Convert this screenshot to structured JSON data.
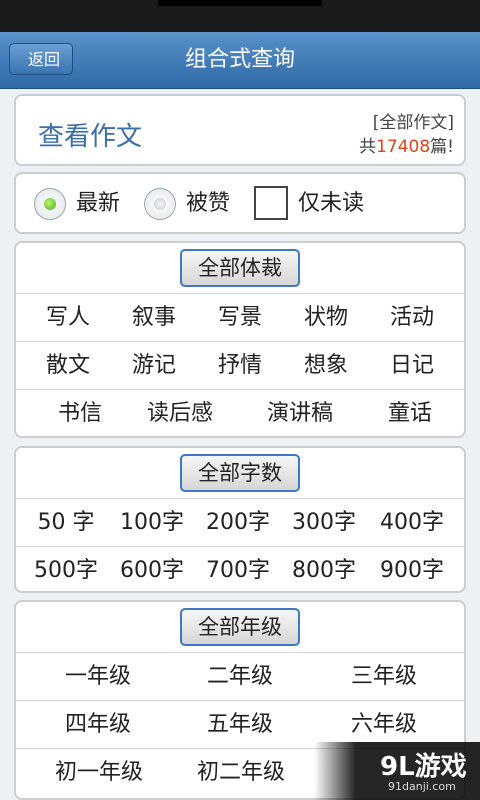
{
  "header": {
    "back_label": "返回",
    "title": "组合式查询"
  },
  "summary": {
    "view_title": "查看作文",
    "scope": "[全部作文]",
    "count_prefix": "共",
    "count": "17408",
    "count_suffix": "篇!"
  },
  "filters": {
    "latest": "最新",
    "liked": "被赞",
    "unread": "仅未读"
  },
  "genre": {
    "header": "全部体裁",
    "rows": [
      [
        "写人",
        "叙事",
        "写景",
        "状物",
        "活动"
      ],
      [
        "散文",
        "游记",
        "抒情",
        "想象",
        "日记"
      ],
      [
        "书信",
        "读后感",
        "演讲稿",
        "童话"
      ]
    ]
  },
  "words": {
    "header": "全部字数",
    "rows": [
      [
        "50 字",
        "100字",
        "200字",
        "300字",
        "400字"
      ],
      [
        "500字",
        "600字",
        "700字",
        "800字",
        "900字"
      ]
    ]
  },
  "grade": {
    "header": "全部年级",
    "rows": [
      [
        "一年级",
        "二年级",
        "三年级"
      ],
      [
        "四年级",
        "五年级",
        "六年级"
      ],
      [
        "初一年级",
        "初二年级"
      ]
    ]
  },
  "watermark": {
    "brand": "9L游戏",
    "url": "91danji.com"
  },
  "colors": {
    "accent": "#3a6ea8",
    "count": "#e0431b",
    "titlebar": "#2f6aa8"
  }
}
